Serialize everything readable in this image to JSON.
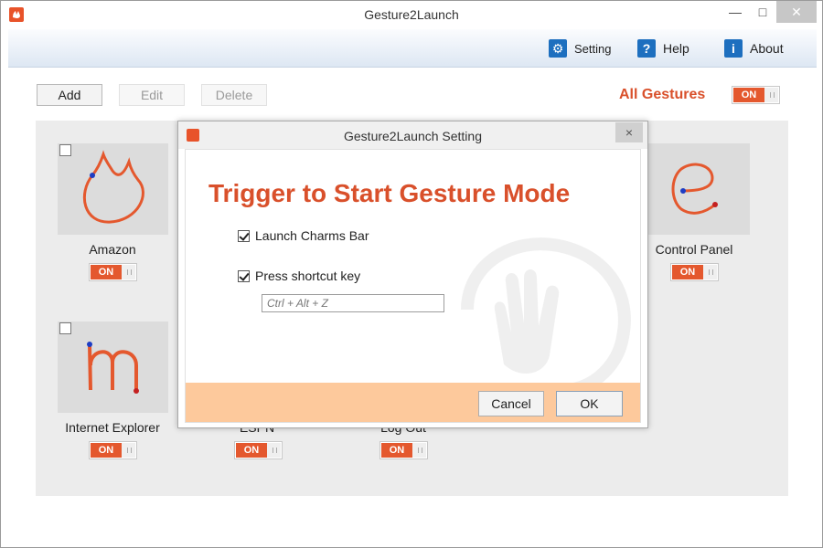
{
  "window": {
    "title": "Gesture2Launch"
  },
  "menu": {
    "setting": "Setting",
    "help": "Help",
    "about": "About",
    "help_icon": "?",
    "about_icon": "i"
  },
  "toolbar": {
    "add": "Add",
    "edit": "Edit",
    "delete": "Delete"
  },
  "all_gestures": {
    "label": "All Gestures",
    "toggle": "ON"
  },
  "gestures": [
    {
      "label": "Amazon",
      "toggle": "ON",
      "icon": "amazon-gesture-icon"
    },
    {
      "label": "Control Panel",
      "toggle": "ON",
      "icon": "e-gesture-icon"
    },
    {
      "label": "Internet Explorer",
      "toggle": "ON",
      "icon": "m-gesture-icon"
    },
    {
      "label": "ESPN",
      "toggle": "ON"
    },
    {
      "label": "Log Out",
      "toggle": "ON"
    }
  ],
  "dialog": {
    "title": "Gesture2Launch Setting",
    "close": "×",
    "heading": "Trigger to Start Gesture Mode",
    "options": [
      {
        "label": "Launch Charms Bar",
        "checked": true
      },
      {
        "label": "Press shortcut key",
        "checked": true
      }
    ],
    "shortcut_value": "Ctrl + Alt + Z",
    "cancel": "Cancel",
    "ok": "OK"
  },
  "colors": {
    "accent": "#e4582e",
    "footer": "#fdc99c"
  }
}
